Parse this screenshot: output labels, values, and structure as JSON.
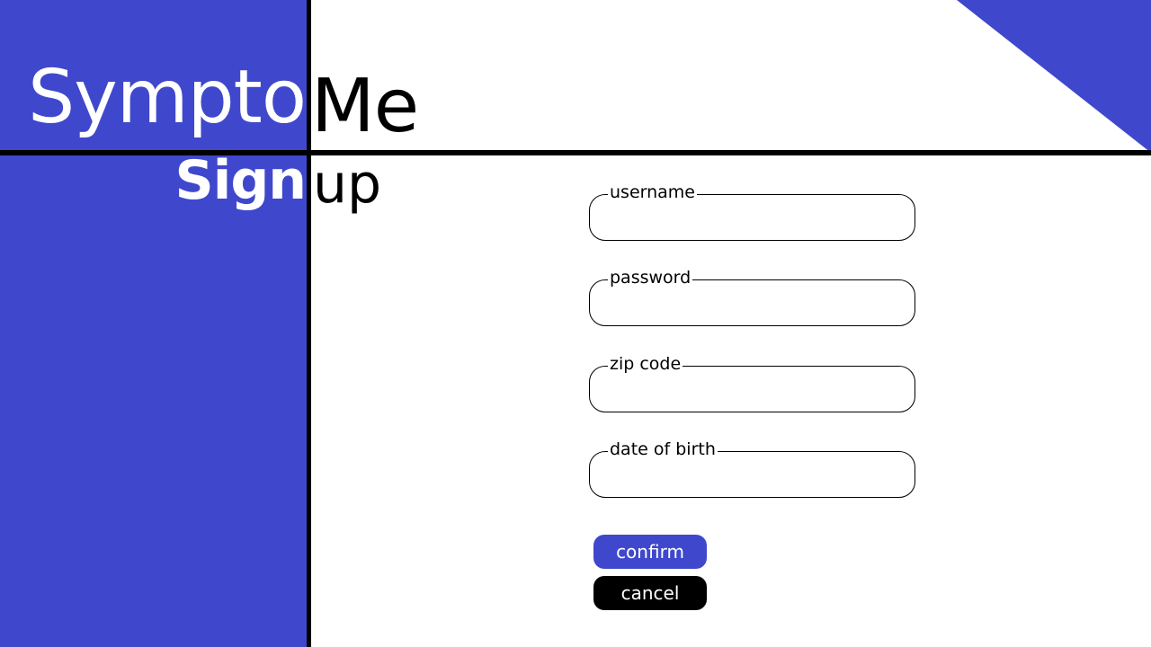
{
  "app": {
    "title_part1": "Sympto",
    "title_part2": "Me"
  },
  "page": {
    "heading_part1": "Sign",
    "heading_part2": "up"
  },
  "form": {
    "fields": [
      {
        "label": "username",
        "value": ""
      },
      {
        "label": "password",
        "value": ""
      },
      {
        "label": "zip code",
        "value": ""
      },
      {
        "label": "date of birth",
        "value": ""
      }
    ],
    "confirm_label": "confirm",
    "cancel_label": "cancel"
  },
  "colors": {
    "accent": "#3f48cc",
    "divider": "#000000",
    "background": "#ffffff",
    "cancel": "#000000"
  }
}
